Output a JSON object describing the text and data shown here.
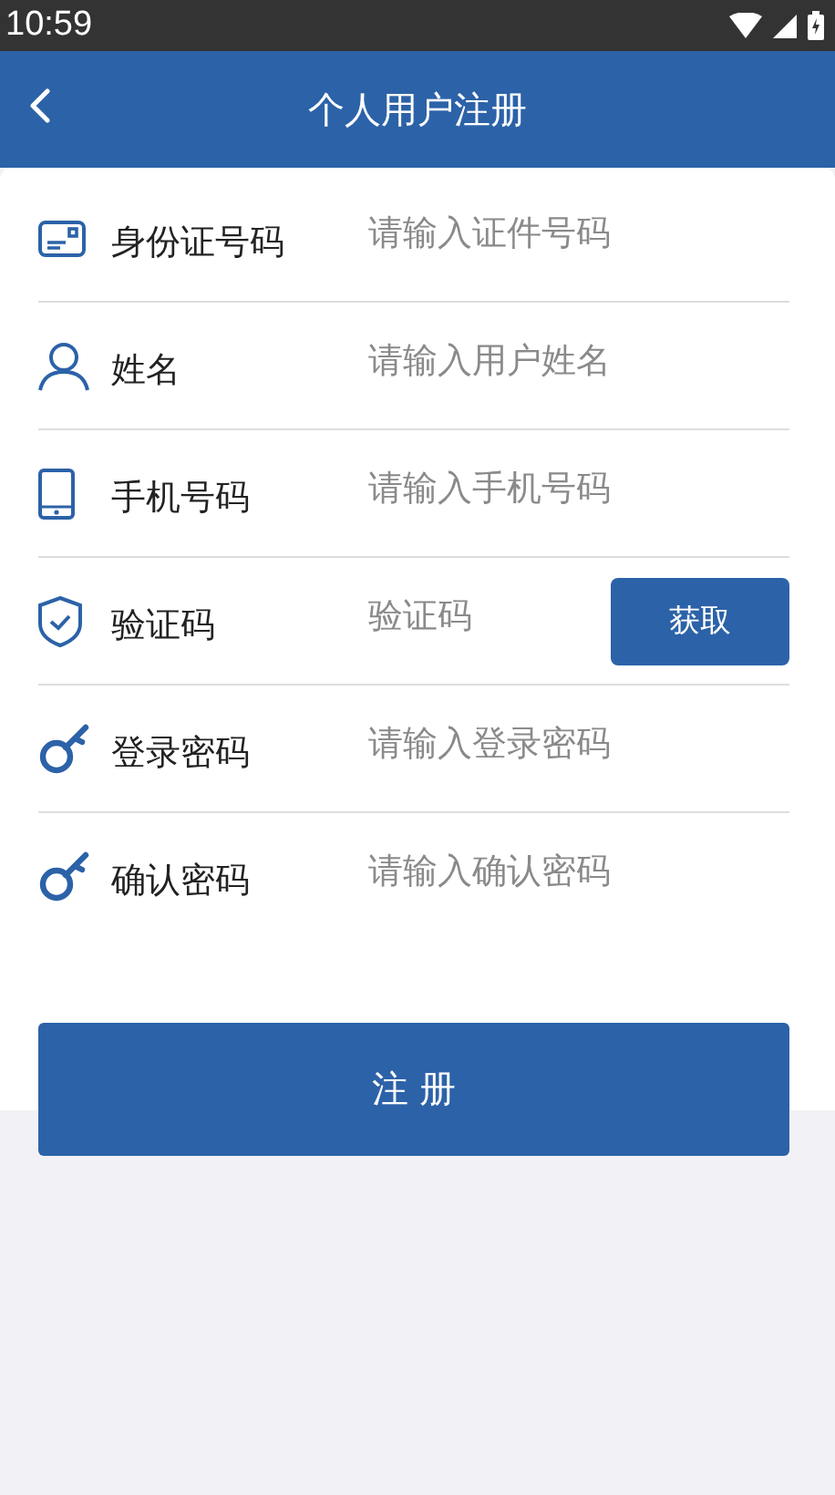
{
  "status_bar": {
    "time": "10:59"
  },
  "header": {
    "title": "个人用户注册"
  },
  "fields": [
    {
      "kind": "idnumber",
      "label": "身份证号码",
      "placeholder": "请输入证件号码"
    },
    {
      "kind": "name",
      "label": "姓名",
      "placeholder": "请输入用户姓名"
    },
    {
      "kind": "phone",
      "label": "手机号码",
      "placeholder": "请输入手机号码"
    },
    {
      "kind": "code",
      "label": "验证码",
      "placeholder": "验证码",
      "button": "获取"
    },
    {
      "kind": "password",
      "label": "登录密码",
      "placeholder": "请输入登录密码"
    },
    {
      "kind": "password",
      "label": "确认密码",
      "placeholder": "请输入确认密码"
    }
  ],
  "submit": "注 册"
}
